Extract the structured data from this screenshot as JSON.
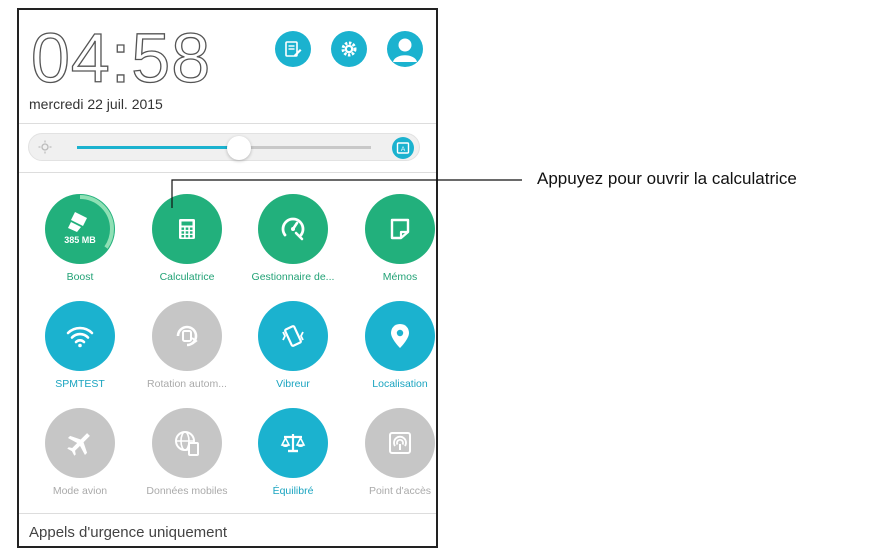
{
  "status": {
    "time": "04:58",
    "date": "mercredi 22 juil. 2015"
  },
  "top_buttons": [
    {
      "icon": "edit-icon"
    },
    {
      "icon": "gear-icon"
    },
    {
      "icon": "user-avatar-icon"
    }
  ],
  "brightness": {
    "level_percent": 55,
    "auto": true
  },
  "tiles": [
    {
      "label": "Boost",
      "icon": "boost-icon",
      "badge": "385 MB",
      "state": "green"
    },
    {
      "label": "Calculatrice",
      "icon": "calculator-icon",
      "state": "green"
    },
    {
      "label": "Gestionnaire de...",
      "icon": "speed-manager-icon",
      "state": "green"
    },
    {
      "label": "Mémos",
      "icon": "memo-icon",
      "state": "green"
    },
    {
      "label": "SPMTEST",
      "icon": "wifi-icon",
      "state": "cyan"
    },
    {
      "label": "Rotation autom...",
      "icon": "rotation-icon",
      "state": "grey"
    },
    {
      "label": "Vibreur",
      "icon": "vibrate-icon",
      "state": "cyan"
    },
    {
      "label": "Localisation",
      "icon": "location-icon",
      "state": "cyan"
    },
    {
      "label": "Mode avion",
      "icon": "airplane-icon",
      "state": "grey"
    },
    {
      "label": "Données mobiles",
      "icon": "mobile-data-icon",
      "state": "grey"
    },
    {
      "label": "Équilibré",
      "icon": "balance-icon",
      "state": "cyan"
    },
    {
      "label": "Point d'accès",
      "icon": "hotspot-icon",
      "state": "grey"
    }
  ],
  "footer": "Appels d'urgence uniquement",
  "callout": "Appuyez pour ouvrir la calculatrice",
  "colors": {
    "green": "#22b07c",
    "cyan": "#1bb2cf",
    "grey": "#c6c6c6"
  }
}
